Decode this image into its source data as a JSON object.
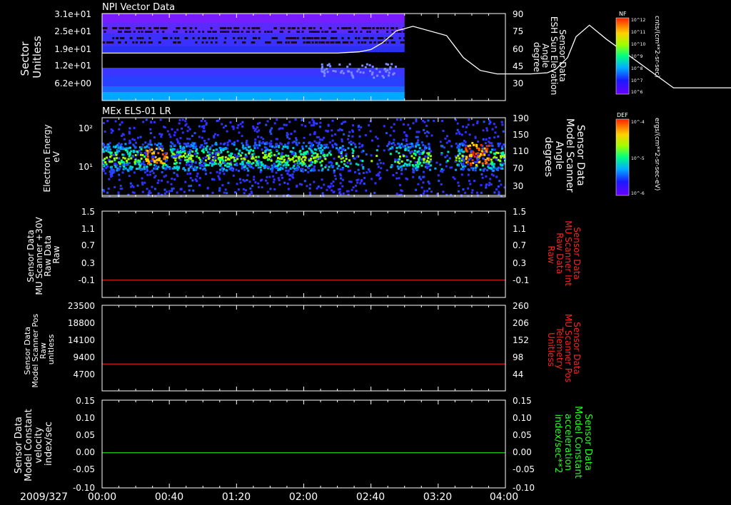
{
  "chart_data": [
    {
      "panel": 1,
      "type": "heatmap",
      "title": "NPI Vector Data",
      "ylabel_left": [
        "Sector",
        "Unitless"
      ],
      "yticks_left": [
        "3.1e+01",
        "2.5e+01",
        "1.9e+01",
        "1.2e+01",
        "6.2e+00"
      ],
      "ylabel_right": [
        "Sensor Data",
        "ESH Sun Elevation",
        "Angle",
        "degree"
      ],
      "yticks_right": [
        "90",
        "75",
        "60",
        "45",
        "30"
      ],
      "ylim_right": [
        15,
        90
      ],
      "data_end_time": "03:00",
      "colorbar": {
        "label": "NF",
        "unit": "cnts/(cm**2-sr-sec)",
        "ticks": [
          "10^12",
          "10^11",
          "10^10",
          "10^9",
          "10^8",
          "10^7",
          "10^6"
        ]
      },
      "line_series": {
        "name": "Sensor Data ESH Sun Elevation Angle",
        "color": "#ffffff",
        "t_min": [
          0,
          140,
          153,
          160,
          167,
          175,
          185,
          205,
          215,
          225,
          235,
          240,
          246,
          255,
          265,
          270,
          277,
          282,
          290,
          300,
          340,
          410,
          480,
          480
        ],
        "values": [
          56,
          56,
          57,
          59,
          65,
          75,
          79,
          71,
          52,
          41,
          38,
          38,
          38,
          38,
          39,
          42,
          52,
          70,
          80,
          68,
          26,
          26,
          26,
          26
        ]
      }
    },
    {
      "panel": 2,
      "type": "heatmap",
      "title": "MEx ELS-01 LR",
      "ylabel_left": [
        "Electron Energy",
        "eV"
      ],
      "yticks_left": [
        "10²",
        "10¹"
      ],
      "ylabel_right": [
        "Sensor Data",
        "Model Scanner",
        "Angle",
        "degrees"
      ],
      "yticks_right": [
        "190",
        "150",
        "110",
        "70",
        "30"
      ],
      "ylim_right": [
        0,
        190
      ],
      "colorbar": {
        "label": "DEF",
        "unit": "ergs/(cm**2-sr-sec-eV)",
        "ticks": [
          "10^-4",
          "10^-5",
          "10^-6"
        ]
      }
    },
    {
      "panel": 3,
      "type": "line",
      "ylabel_left": [
        "Sensor Data",
        "MU Scanner +30V",
        "Raw Data",
        "Raw"
      ],
      "yticks_left": [
        "1.5",
        "1.1",
        "0.7",
        "0.3",
        "-0.1"
      ],
      "ylim": [
        -0.5,
        1.5
      ],
      "ylabel_right": [
        "Sensor Data",
        "MU Scanner Int",
        "Raw Data",
        "Raw"
      ],
      "yticks_right": [
        "1.5",
        "1.1",
        "0.7",
        "0.3",
        "-0.1"
      ],
      "series": [
        {
          "color": "#ff2020",
          "value": -0.1
        }
      ]
    },
    {
      "panel": 4,
      "type": "line",
      "ylabel_left": [
        "Sensor Data",
        "Model Scanner Pos",
        "Raw",
        "unitless"
      ],
      "yticks_left": [
        "23500",
        "18800",
        "14100",
        "9400",
        "4700"
      ],
      "ylim": [
        0,
        23500
      ],
      "ylabel_right": [
        "Sensor Data",
        "MU Scanner Pos",
        "Telemetry",
        "Unitless"
      ],
      "yticks_right": [
        "260",
        "206",
        "152",
        "98",
        "44"
      ],
      "series": [
        {
          "color": "#ff2020",
          "value": 7400
        }
      ]
    },
    {
      "panel": 5,
      "type": "line",
      "ylabel_left": [
        "Sensor Data",
        "Model Constant",
        "velocity",
        "index/sec"
      ],
      "yticks_left": [
        "0.15",
        "0.10",
        "0.05",
        "0.00",
        "-0.05",
        "-0.10"
      ],
      "ylim": [
        -0.1,
        0.15
      ],
      "ylabel_right": [
        "Sensor Data",
        "Model Constant",
        "acceleration",
        "index/sec**2"
      ],
      "yticks_right": [
        "0.15",
        "0.10",
        "0.05",
        "0.00",
        "-0.05",
        "-0.10"
      ],
      "series": [
        {
          "color": "#20ff20",
          "value": 0.0
        }
      ]
    }
  ],
  "x_axis": {
    "date": "2009/327",
    "ticks": [
      "00:00",
      "00:40",
      "01:20",
      "02:00",
      "02:40",
      "03:20",
      "04:00"
    ]
  },
  "colors": {
    "background": "#000000",
    "axes": "#ffffff",
    "red_label": "#ff2020",
    "green_label": "#20ff20"
  }
}
